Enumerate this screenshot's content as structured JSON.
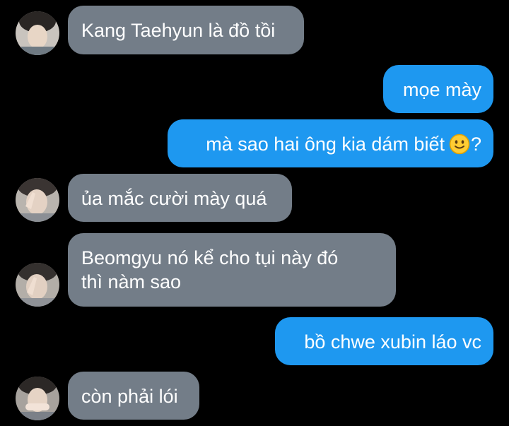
{
  "chat": {
    "messages": [
      {
        "side": "in",
        "text": "Kang Taehyun là đồ tồi"
      },
      {
        "side": "out",
        "text": "mọe mày"
      },
      {
        "side": "out",
        "text_before": "mà sao hai ông kia dám biết",
        "emoji": "slightly-smiling-face-icon",
        "text_after": "?"
      },
      {
        "side": "in",
        "text": "ủa mắc cười mày quá"
      },
      {
        "side": "in",
        "lines": [
          "Beomgyu nó kể cho tụi này đó",
          "thì nàm sao"
        ]
      },
      {
        "side": "out",
        "text": "bồ chwe xubin láo vc"
      },
      {
        "side": "in",
        "text": "còn phải lói"
      }
    ]
  },
  "colors": {
    "background": "#000000",
    "incoming_bubble": "#737d88",
    "outgoing_bubble": "#1e98f0",
    "text": "#ffffff"
  }
}
